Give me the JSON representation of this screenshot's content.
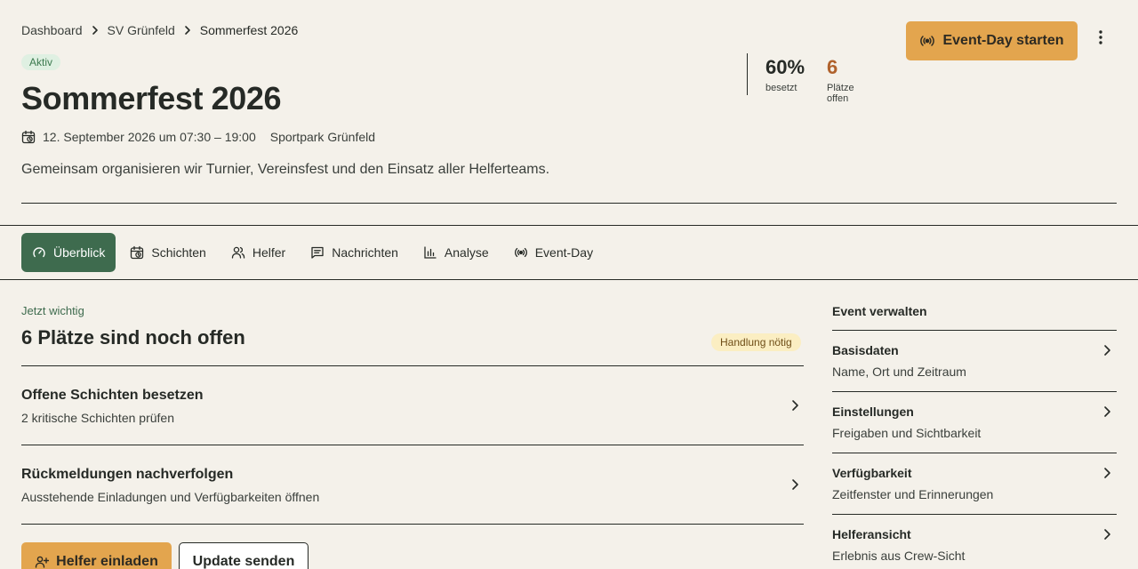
{
  "breadcrumb": [
    "Dashboard",
    "SV Grünfeld",
    "Sommerfest 2026"
  ],
  "status": "Aktiv",
  "event": {
    "title": "Sommerfest 2026",
    "date": "12. September 2026 um 07:30 – 19:00",
    "location": "Sportpark Grünfeld",
    "description": "Gemeinsam organisieren wir Turnier, Vereinsfest und den Einsatz aller Helferteams."
  },
  "stats": [
    {
      "value": "60%",
      "label": "besetzt"
    },
    {
      "value": "6",
      "label": "Plätze offen"
    }
  ],
  "header_actions": {
    "start_label": "Event-Day starten"
  },
  "tabs": [
    {
      "label": "Überblick",
      "icon": "gauge-icon",
      "active": true
    },
    {
      "label": "Schichten",
      "icon": "calendar-icon"
    },
    {
      "label": "Helfer",
      "icon": "users-icon"
    },
    {
      "label": "Nachrichten",
      "icon": "message-icon"
    },
    {
      "label": "Analyse",
      "icon": "bar-chart-icon"
    },
    {
      "label": "Event-Day",
      "icon": "broadcast-icon"
    }
  ],
  "main": {
    "kicker": "Jetzt wichtig",
    "title": "6 Plätze sind noch offen",
    "badge": "Handlung nötig",
    "tasks": [
      {
        "title": "Offene Schichten besetzen",
        "subtitle": "2 kritische Schichten prüfen"
      },
      {
        "title": "Rückmeldungen nachverfolgen",
        "subtitle": "Ausstehende Einladungen und Verfügbarkeiten öffnen"
      }
    ],
    "invite_label": "Helfer einladen",
    "update_label": "Update senden"
  },
  "side": {
    "title": "Event verwalten",
    "items": [
      {
        "title": "Basisdaten",
        "subtitle": "Name, Ort und Zeitraum"
      },
      {
        "title": "Einstellungen",
        "subtitle": "Freigaben und Sichtbarkeit"
      },
      {
        "title": "Verfügbarkeit",
        "subtitle": "Zeitfenster und Erinnerungen"
      },
      {
        "title": "Helferansicht",
        "subtitle": "Erlebnis aus Crew-Sicht"
      }
    ]
  },
  "colors": {
    "background": "#f4f1ea",
    "accent": "#e3a54e",
    "primary_green": "#3e6b4e",
    "open_count": "#b0622c"
  }
}
